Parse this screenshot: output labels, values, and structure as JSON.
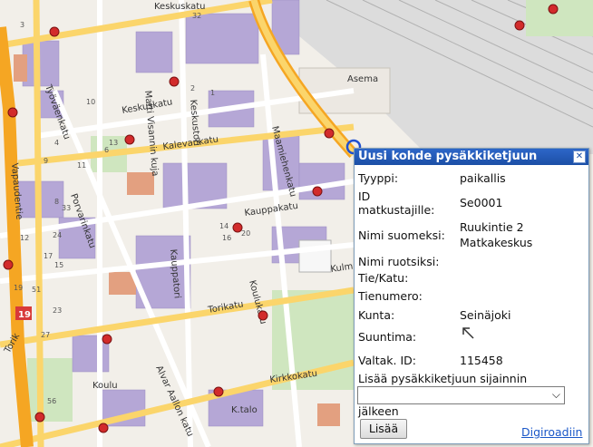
{
  "map": {
    "streets": [
      "Keskuskatu",
      "Keskuskatu",
      "Keskustori",
      "Työväenkatu",
      "Kalevankatu",
      "Matti Visannin kuja",
      "Maamiehenkatu",
      "Kauppakatu",
      "Porvarinkatu",
      "Vapaudentie",
      "Kauppatori",
      "Koulukatu",
      "Torikatu",
      "Kirkkokatu",
      "Alvar Aallon katu",
      "Kulma",
      "Torik"
    ],
    "places": [
      "Asema",
      "Koulu",
      "K.talo"
    ],
    "road_shield": "19",
    "house_numbers": [
      "1",
      "2",
      "3",
      "4",
      "6",
      "8",
      "9",
      "10",
      "11",
      "12",
      "13",
      "14",
      "15",
      "16",
      "17",
      "19",
      "20",
      "23",
      "24",
      "27",
      "32",
      "33",
      "51",
      "56"
    ],
    "colors": {
      "highway": "#f5a623",
      "primary": "#fbd56b",
      "building": "#b5a7d6",
      "park": "#cfe6bf",
      "stop": "#d22b2b",
      "selected_stop": "#2050d0"
    }
  },
  "popup": {
    "title": "Uusi kohde pysäkkiketjuun",
    "close_icon": "close-icon",
    "fields": {
      "tyyppi_label": "Tyyppi:",
      "tyyppi_value": "paikallis",
      "id_label_1": "ID",
      "id_label_2": "matkustajille:",
      "id_value": "Se0001",
      "nimi_fi_label": "Nimi suomeksi:",
      "nimi_fi_value_1": "Ruukintie 2",
      "nimi_fi_value_2": "Matkakeskus",
      "nimi_sv_label": "Nimi ruotsiksi:",
      "tie_label": "Tie/Katu:",
      "tienumero_label": "Tienumero:",
      "kunta_label": "Kunta:",
      "kunta_value": "Seinäjoki",
      "suuntima_label": "Suuntima:",
      "suuntima_icon": "arrow-up-left-icon",
      "valtak_label": "Valtak. ID:",
      "valtak_value": "115458"
    },
    "insert_label_1": "Lisää pysäkkiketjuun sijainnin",
    "insert_label_2": "jälkeen",
    "select_value": "",
    "add_button": "Lisää",
    "link": "Digiroadiin"
  }
}
